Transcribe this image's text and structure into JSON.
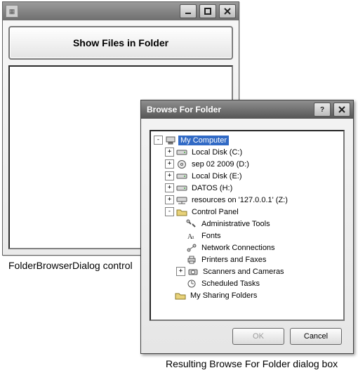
{
  "main_window": {
    "button_label": "Show Files in Folder"
  },
  "caption_main": "FolderBrowserDialog control",
  "caption_dialog": "Resulting Browse For Folder dialog box",
  "dialog": {
    "title": "Browse For Folder",
    "ok_label": "OK",
    "cancel_label": "Cancel",
    "tree": [
      {
        "depth": 0,
        "toggle": "-",
        "icon": "computer",
        "label": "My Computer",
        "selected": true
      },
      {
        "depth": 1,
        "toggle": "+",
        "icon": "drive",
        "label": "Local Disk (C:)"
      },
      {
        "depth": 1,
        "toggle": "+",
        "icon": "disc",
        "label": "sep 02 2009 (D:)"
      },
      {
        "depth": 1,
        "toggle": "+",
        "icon": "drive",
        "label": "Local Disk (E:)"
      },
      {
        "depth": 1,
        "toggle": "+",
        "icon": "drive",
        "label": "DATOS (H:)"
      },
      {
        "depth": 1,
        "toggle": "+",
        "icon": "netdrive",
        "label": "resources on '127.0.0.1' (Z:)"
      },
      {
        "depth": 1,
        "toggle": "-",
        "icon": "folder",
        "label": "Control Panel"
      },
      {
        "depth": 2,
        "toggle": "",
        "icon": "tools",
        "label": "Administrative Tools"
      },
      {
        "depth": 2,
        "toggle": "",
        "icon": "fonts",
        "label": "Fonts"
      },
      {
        "depth": 2,
        "toggle": "",
        "icon": "network",
        "label": "Network Connections"
      },
      {
        "depth": 2,
        "toggle": "",
        "icon": "printer",
        "label": "Printers and Faxes"
      },
      {
        "depth": 2,
        "toggle": "+",
        "icon": "camera",
        "label": "Scanners and Cameras"
      },
      {
        "depth": 2,
        "toggle": "",
        "icon": "clock",
        "label": "Scheduled Tasks"
      },
      {
        "depth": 1,
        "toggle": "",
        "icon": "folder",
        "label": "My Sharing Folders"
      }
    ]
  }
}
